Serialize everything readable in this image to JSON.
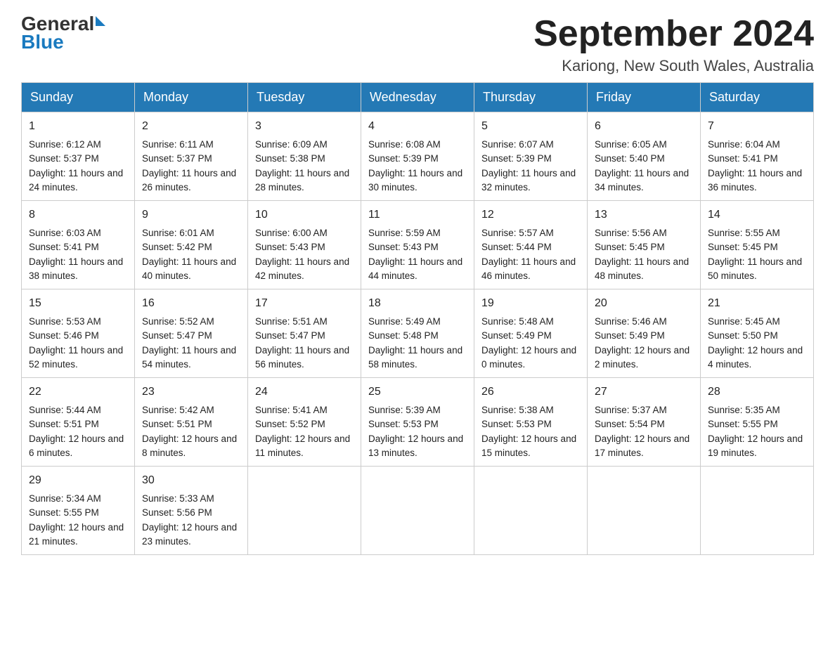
{
  "header": {
    "logo_general": "General",
    "logo_blue": "Blue",
    "month_title": "September 2024",
    "location": "Kariong, New South Wales, Australia"
  },
  "weekdays": [
    "Sunday",
    "Monday",
    "Tuesday",
    "Wednesday",
    "Thursday",
    "Friday",
    "Saturday"
  ],
  "weeks": [
    [
      {
        "day": "1",
        "sunrise": "6:12 AM",
        "sunset": "5:37 PM",
        "daylight": "11 hours and 24 minutes."
      },
      {
        "day": "2",
        "sunrise": "6:11 AM",
        "sunset": "5:37 PM",
        "daylight": "11 hours and 26 minutes."
      },
      {
        "day": "3",
        "sunrise": "6:09 AM",
        "sunset": "5:38 PM",
        "daylight": "11 hours and 28 minutes."
      },
      {
        "day": "4",
        "sunrise": "6:08 AM",
        "sunset": "5:39 PM",
        "daylight": "11 hours and 30 minutes."
      },
      {
        "day": "5",
        "sunrise": "6:07 AM",
        "sunset": "5:39 PM",
        "daylight": "11 hours and 32 minutes."
      },
      {
        "day": "6",
        "sunrise": "6:05 AM",
        "sunset": "5:40 PM",
        "daylight": "11 hours and 34 minutes."
      },
      {
        "day": "7",
        "sunrise": "6:04 AM",
        "sunset": "5:41 PM",
        "daylight": "11 hours and 36 minutes."
      }
    ],
    [
      {
        "day": "8",
        "sunrise": "6:03 AM",
        "sunset": "5:41 PM",
        "daylight": "11 hours and 38 minutes."
      },
      {
        "day": "9",
        "sunrise": "6:01 AM",
        "sunset": "5:42 PM",
        "daylight": "11 hours and 40 minutes."
      },
      {
        "day": "10",
        "sunrise": "6:00 AM",
        "sunset": "5:43 PM",
        "daylight": "11 hours and 42 minutes."
      },
      {
        "day": "11",
        "sunrise": "5:59 AM",
        "sunset": "5:43 PM",
        "daylight": "11 hours and 44 minutes."
      },
      {
        "day": "12",
        "sunrise": "5:57 AM",
        "sunset": "5:44 PM",
        "daylight": "11 hours and 46 minutes."
      },
      {
        "day": "13",
        "sunrise": "5:56 AM",
        "sunset": "5:45 PM",
        "daylight": "11 hours and 48 minutes."
      },
      {
        "day": "14",
        "sunrise": "5:55 AM",
        "sunset": "5:45 PM",
        "daylight": "11 hours and 50 minutes."
      }
    ],
    [
      {
        "day": "15",
        "sunrise": "5:53 AM",
        "sunset": "5:46 PM",
        "daylight": "11 hours and 52 minutes."
      },
      {
        "day": "16",
        "sunrise": "5:52 AM",
        "sunset": "5:47 PM",
        "daylight": "11 hours and 54 minutes."
      },
      {
        "day": "17",
        "sunrise": "5:51 AM",
        "sunset": "5:47 PM",
        "daylight": "11 hours and 56 minutes."
      },
      {
        "day": "18",
        "sunrise": "5:49 AM",
        "sunset": "5:48 PM",
        "daylight": "11 hours and 58 minutes."
      },
      {
        "day": "19",
        "sunrise": "5:48 AM",
        "sunset": "5:49 PM",
        "daylight": "12 hours and 0 minutes."
      },
      {
        "day": "20",
        "sunrise": "5:46 AM",
        "sunset": "5:49 PM",
        "daylight": "12 hours and 2 minutes."
      },
      {
        "day": "21",
        "sunrise": "5:45 AM",
        "sunset": "5:50 PM",
        "daylight": "12 hours and 4 minutes."
      }
    ],
    [
      {
        "day": "22",
        "sunrise": "5:44 AM",
        "sunset": "5:51 PM",
        "daylight": "12 hours and 6 minutes."
      },
      {
        "day": "23",
        "sunrise": "5:42 AM",
        "sunset": "5:51 PM",
        "daylight": "12 hours and 8 minutes."
      },
      {
        "day": "24",
        "sunrise": "5:41 AM",
        "sunset": "5:52 PM",
        "daylight": "12 hours and 11 minutes."
      },
      {
        "day": "25",
        "sunrise": "5:39 AM",
        "sunset": "5:53 PM",
        "daylight": "12 hours and 13 minutes."
      },
      {
        "day": "26",
        "sunrise": "5:38 AM",
        "sunset": "5:53 PM",
        "daylight": "12 hours and 15 minutes."
      },
      {
        "day": "27",
        "sunrise": "5:37 AM",
        "sunset": "5:54 PM",
        "daylight": "12 hours and 17 minutes."
      },
      {
        "day": "28",
        "sunrise": "5:35 AM",
        "sunset": "5:55 PM",
        "daylight": "12 hours and 19 minutes."
      }
    ],
    [
      {
        "day": "29",
        "sunrise": "5:34 AM",
        "sunset": "5:55 PM",
        "daylight": "12 hours and 21 minutes."
      },
      {
        "day": "30",
        "sunrise": "5:33 AM",
        "sunset": "5:56 PM",
        "daylight": "12 hours and 23 minutes."
      },
      null,
      null,
      null,
      null,
      null
    ]
  ]
}
